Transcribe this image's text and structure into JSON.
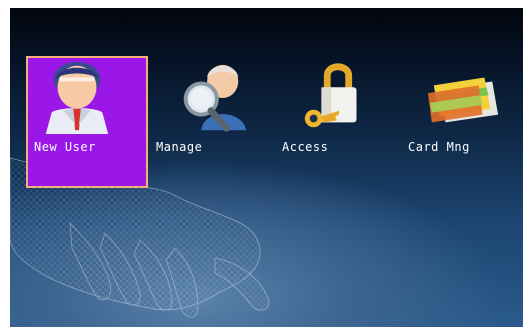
{
  "menu": {
    "items": [
      {
        "label": "New User",
        "icon": "new-user-icon",
        "selected": true
      },
      {
        "label": "Manage",
        "icon": "manage-users-icon",
        "selected": false
      },
      {
        "label": "Access",
        "icon": "access-lock-icon",
        "selected": false
      },
      {
        "label": "Card Mng",
        "icon": "card-icon",
        "selected": false
      }
    ]
  },
  "colors": {
    "selected_bg": "#9a17e8",
    "selected_border": "#f4b07a",
    "label_text": "#ffffff"
  }
}
